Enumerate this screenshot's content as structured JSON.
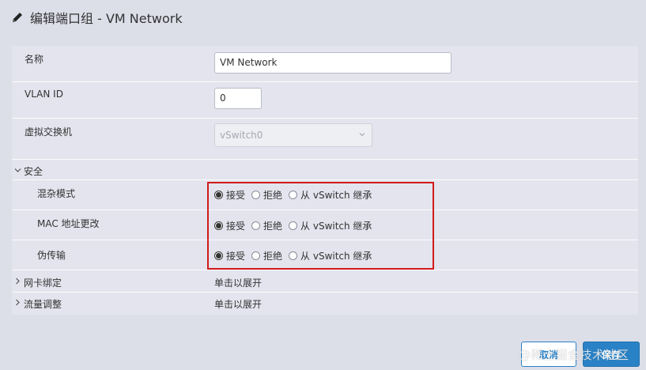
{
  "dialog": {
    "title": "编辑端口组 - VM Network"
  },
  "fields": {
    "name_label": "名称",
    "name_value": "VM Network",
    "vlan_label": "VLAN ID",
    "vlan_value": "0",
    "vswitch_label": "虚拟交换机",
    "vswitch_value": "vSwitch0"
  },
  "security": {
    "section_label": "安全",
    "rows": [
      {
        "label": "混杂模式",
        "selected": "accept"
      },
      {
        "label": "MAC 地址更改",
        "selected": "accept"
      },
      {
        "label": "伪传输",
        "selected": "accept"
      }
    ],
    "options": {
      "accept": "接受",
      "reject": "拒绝",
      "inherit": "从 vSwitch 继承"
    }
  },
  "nic_teaming": {
    "label": "网卡绑定",
    "value": "单击以展开"
  },
  "traffic_shaping": {
    "label": "流量调整",
    "value": "单击以展开"
  },
  "buttons": {
    "cancel": "取消",
    "save": "保存"
  },
  "watermark": "@稀土掘金技术社区",
  "colors": {
    "accent": "#2a82c6",
    "highlight": "#d11a1a",
    "background": "#dcdee8",
    "row_bg": "#e3e4ed"
  }
}
